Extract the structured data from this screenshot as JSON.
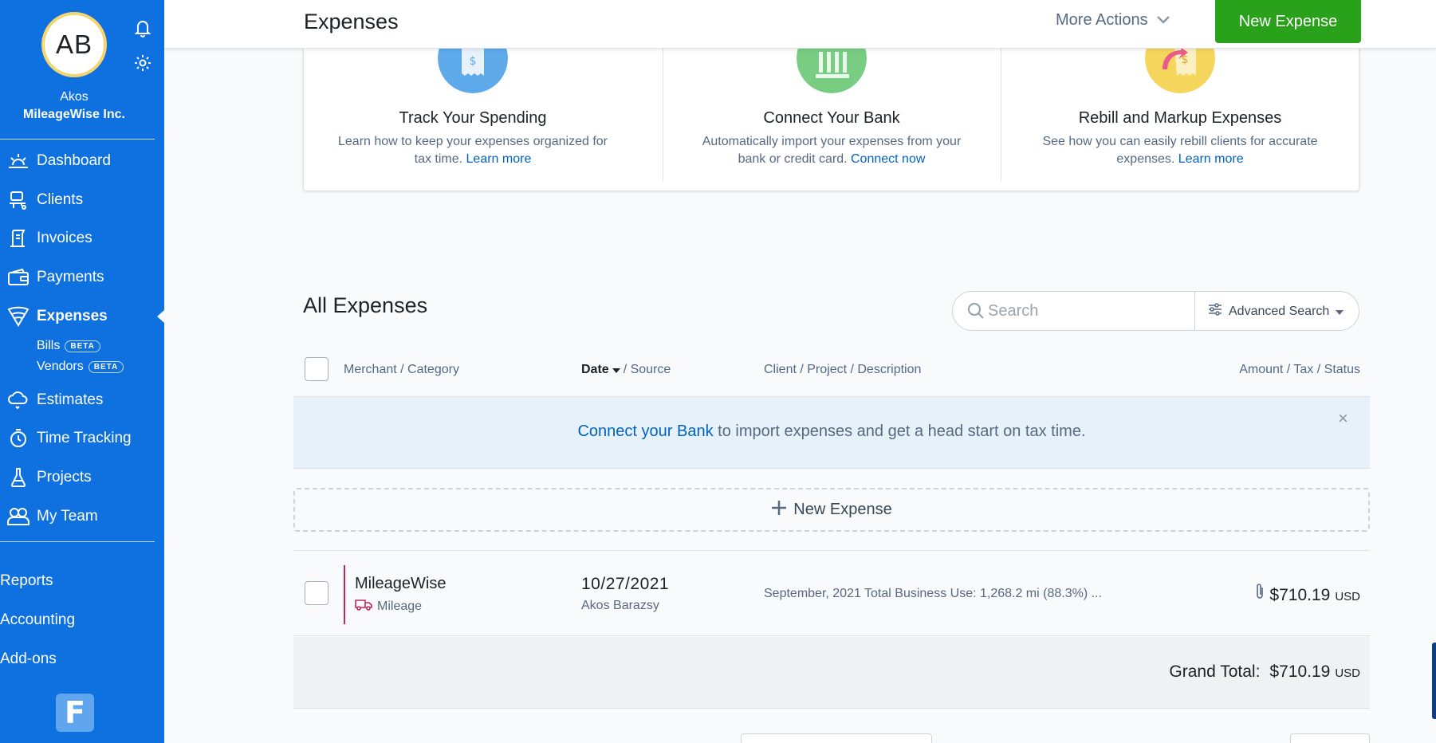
{
  "sidebar": {
    "avatar_initials": "AB",
    "user_name": "Akos",
    "company": "MileageWise Inc.",
    "nav": [
      {
        "label": "Dashboard",
        "icon": "sun-icon"
      },
      {
        "label": "Clients",
        "icon": "clients-icon"
      },
      {
        "label": "Invoices",
        "icon": "invoice-icon"
      },
      {
        "label": "Payments",
        "icon": "wallet-icon"
      },
      {
        "label": "Expenses",
        "icon": "expenses-icon",
        "active": true
      },
      {
        "label": "Estimates",
        "icon": "cloud-icon"
      },
      {
        "label": "Time Tracking",
        "icon": "stopwatch-icon"
      },
      {
        "label": "Projects",
        "icon": "flask-icon"
      },
      {
        "label": "My Team",
        "icon": "team-icon"
      }
    ],
    "sub_items": [
      {
        "label": "Bills",
        "badge": "BETA"
      },
      {
        "label": "Vendors",
        "badge": "BETA"
      }
    ],
    "bottom_nav": [
      "Reports",
      "Accounting",
      "Add-ons"
    ],
    "logo_letter": "F"
  },
  "header": {
    "title": "Expenses",
    "more_actions": "More Actions",
    "new_expense": "New Expense"
  },
  "cards": [
    {
      "title": "Track Your Spending",
      "text": "Learn how to keep your expenses organized for tax time. ",
      "link": "Learn more"
    },
    {
      "title": "Connect Your Bank",
      "text": "Automatically import your expenses from your bank or credit card. ",
      "link": "Connect now"
    },
    {
      "title": "Rebill and Markup Expenses",
      "text": "See how you can easily rebill clients for accurate expenses. ",
      "link": "Learn more"
    }
  ],
  "list": {
    "title": "All Expenses",
    "search_placeholder": "Search",
    "advanced_search": "Advanced Search",
    "columns": {
      "merchant": "Merchant / Category",
      "date": "Date",
      "source": "/ Source",
      "client": "Client / Project / Description",
      "amount": "Amount / Tax / Status"
    },
    "banner_link": "Connect your Bank",
    "banner_text": " to import expenses and get a head start on tax time.",
    "banner_close": "×",
    "new_row": "New Expense",
    "rows": [
      {
        "merchant": "MileageWise",
        "category": "Mileage",
        "date": "10/27/2021",
        "source": "Akos Barazsy",
        "description": "September, 2021 Total Business Use: 1,268.2 mi (88.3%) ...",
        "amount": "$710.19",
        "currency": "USD"
      }
    ],
    "grand_total_label": "Grand Total:",
    "grand_total": "$710.19",
    "grand_total_currency": "USD"
  },
  "colors": {
    "sidebar": "#0f71e0",
    "primary_button": "#2aa11b",
    "link": "#0063c1",
    "banner": "#e6f1fa",
    "mileage_accent": "#c4265c"
  }
}
